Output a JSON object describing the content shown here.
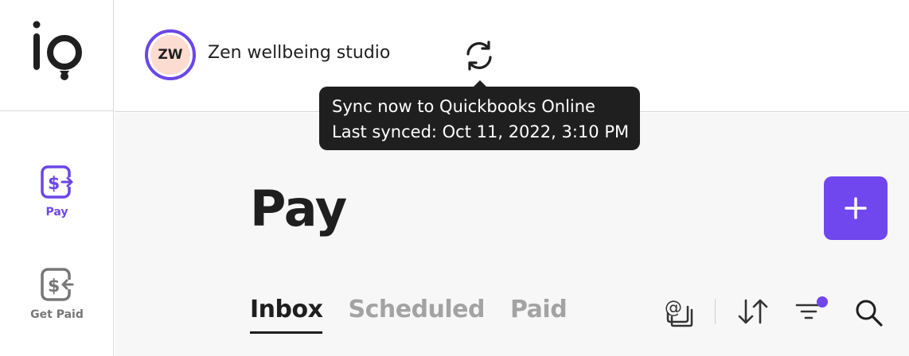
{
  "brand": {
    "logo_text": "io",
    "accent": "#6b46e8"
  },
  "sidebar": {
    "items": [
      {
        "label": "Pay",
        "icon": "dollar-send-icon",
        "active": true
      },
      {
        "label": "Get Paid",
        "icon": "dollar-receive-icon",
        "active": false
      }
    ]
  },
  "header": {
    "avatar_initials": "ZW",
    "company_name": "Zen wellbeing studio",
    "sync_icon": "sync-icon"
  },
  "tooltip": {
    "line1": "Sync now to Quickbooks Online",
    "line2": "Last synced: Oct 11, 2022, 3:10 PM"
  },
  "main": {
    "title": "Pay",
    "add_icon": "plus-icon",
    "tabs": [
      {
        "label": "Inbox",
        "active": true
      },
      {
        "label": "Scheduled",
        "active": false
      },
      {
        "label": "Paid",
        "active": false
      }
    ],
    "toolbar": [
      "email-inbox-icon",
      "sort-icon",
      "filter-icon",
      "search-icon"
    ]
  }
}
